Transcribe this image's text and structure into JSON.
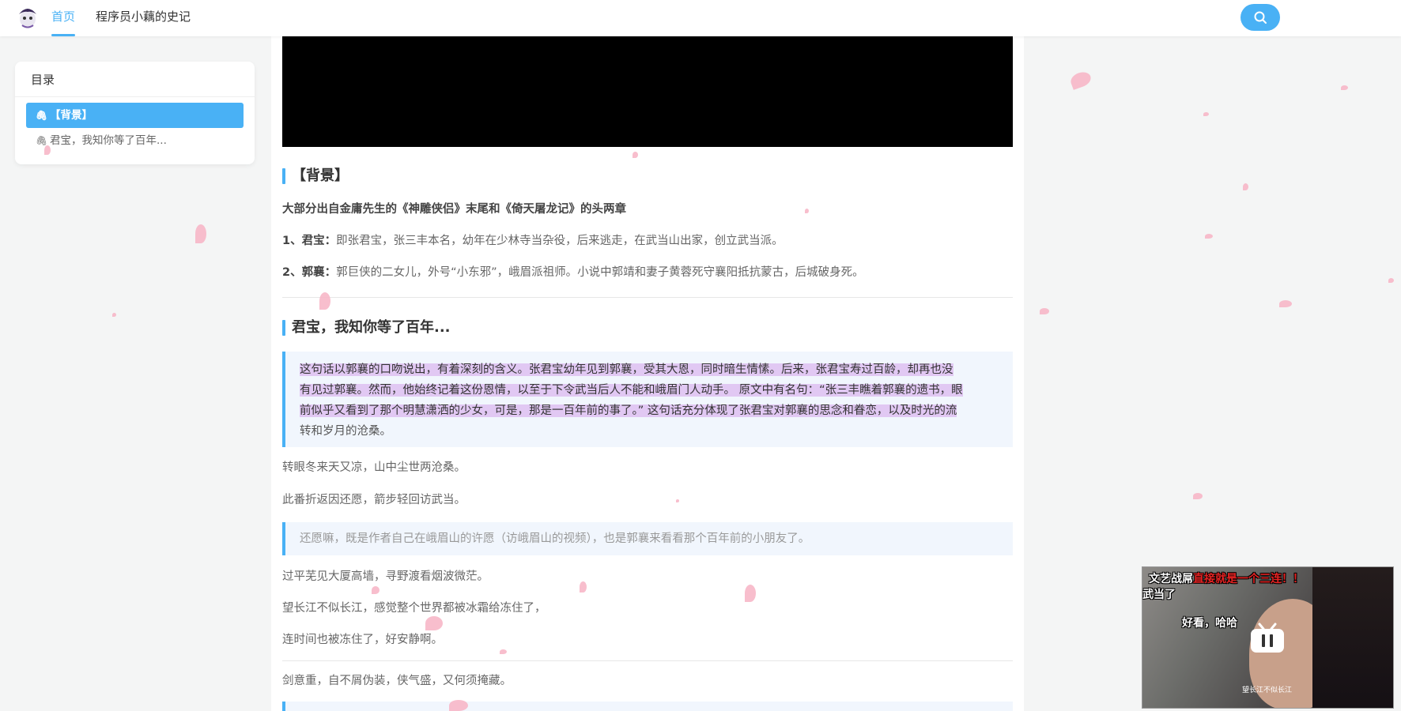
{
  "nav": {
    "home": "首页",
    "site_title": "程序员小藕的史记",
    "accent": "#49b1f5"
  },
  "toc": {
    "title": "目录",
    "items": [
      {
        "label": "【背景】",
        "active": true
      },
      {
        "label": "君宝，我知你等了百年...",
        "active": false
      }
    ]
  },
  "article": {
    "section1": {
      "heading": "【背景】",
      "intro": "大部分出自金庸先生的《神雕侠侣》末尾和《倚天屠龙记》的头两章",
      "item1_label": "1、君宝：",
      "item1_text": "即张君宝，张三丰本名，幼年在少林寺当杂役，后来逃走，在武当山出家，创立武当派。",
      "item2_label": "2、郭襄：",
      "item2_text": "郭巨侠的二女儿，外号“小东邪”，峨眉派祖师。小说中郭靖和妻子黄蓉死守襄阳抵抗蒙古，后城破身死。"
    },
    "section2": {
      "heading": "君宝，我知你等了百年...",
      "quote1_lines": [
        "这句话以郭襄的口吻说出，有着深刻的含义。张君宝幼年见到郭襄，受其大恩，同时暗生情愫。后来，张君宝寿过百龄，却再也没",
        "有见过郭襄。然而，他始终记着这份恩情，以至于下令武当后人不能和峨眉门人动手。 原文中有名句：“张三丰瞧着郭襄的遗书，眼",
        "前似乎又看到了那个明慧潇洒的少女，可是，那是一百年前的事了。” 这句话充分体现了张君宝对郭襄的思念和眷恋，以及时光的流",
        "转和岁月的沧桑。"
      ],
      "line1": "转眼冬来天又凉，山中尘世两沧桑。",
      "line2": "此番折返因还愿，箭步轻回访武当。",
      "quote2": "还愿嘛，既是作者自己在峨眉山的许愿（访峨眉山的视频），也是郭襄来看看那个百年前的小朋友了。",
      "line3": "过平芜见大厦高墙，寻野渡看烟波微茫。",
      "line4": "望长江不似长江，感觉整个世界都被冰霜给冻住了，",
      "line5": "连时间也被冻住了，好安静啊。",
      "line6": "剑意重，自不屑伪装，侠气盛，又何须掩藏。"
    }
  },
  "miniplayer": {
    "danmaku1": "文艺战屌",
    "danmaku1_red": "直接就是一个三连！！",
    "danmaku2": "武当了",
    "danmaku3": "好看，哈哈",
    "caption": "望长江不似长江"
  }
}
